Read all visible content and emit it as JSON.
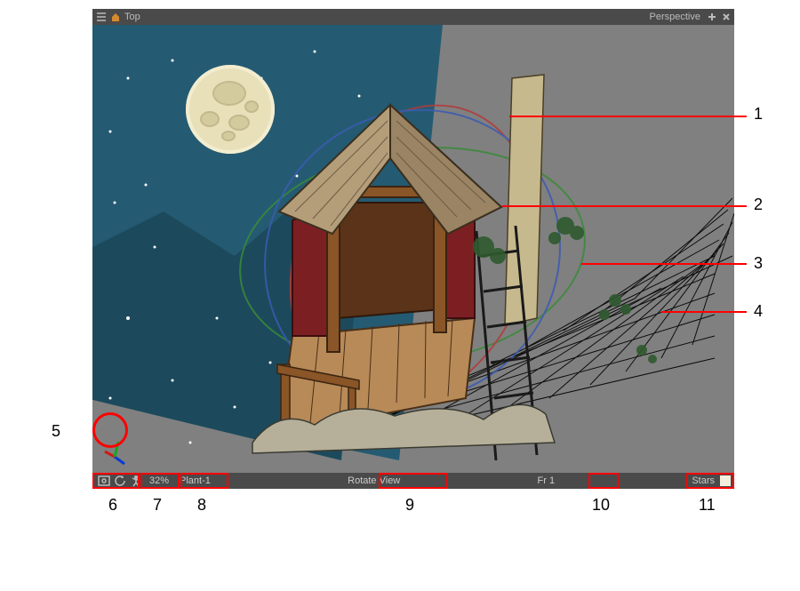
{
  "header": {
    "title": "Top",
    "view_mode": "Perspective"
  },
  "bottom_bar": {
    "zoom": "32%",
    "selected_layer": "Plant-1",
    "tool": "Rotate View",
    "frame_label": "Fr 1",
    "color_label": "Stars"
  },
  "annotations": {
    "n1": "1",
    "n2": "2",
    "n3": "3",
    "n4": "4",
    "n5": "5",
    "n6": "6",
    "n7": "7",
    "n8": "8",
    "n9": "9",
    "n10": "10",
    "n11": "11"
  }
}
